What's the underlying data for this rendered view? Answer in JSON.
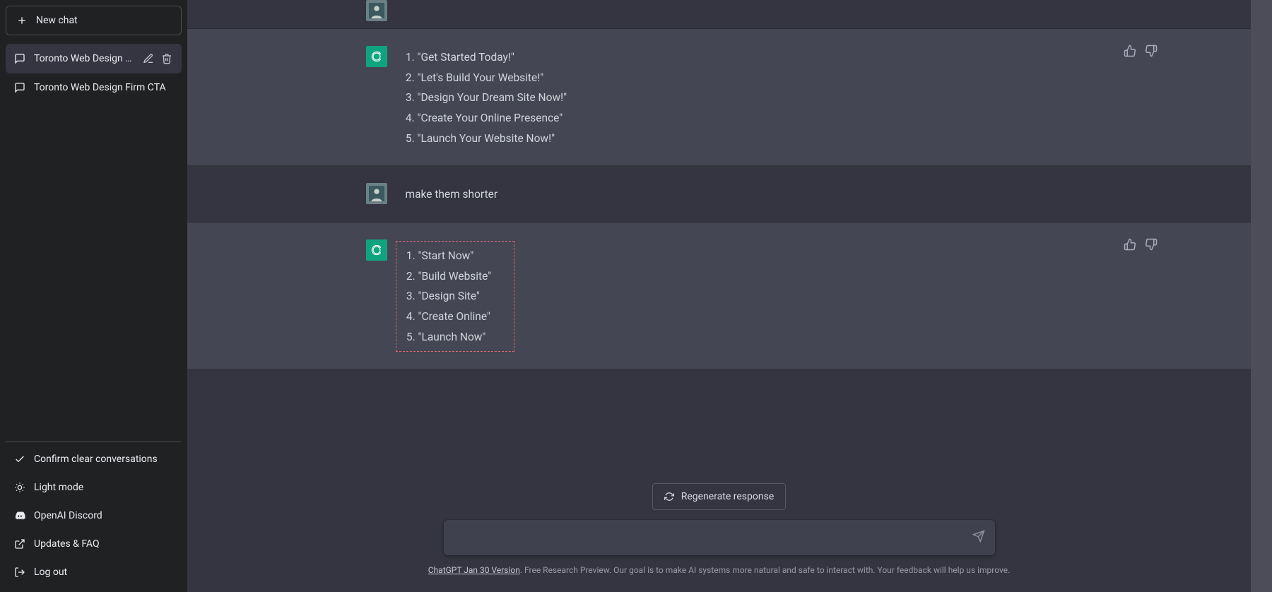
{
  "sidebar": {
    "new_chat": "New chat",
    "chats": [
      {
        "title": "Toronto Web Design SI",
        "active": true
      },
      {
        "title": "Toronto Web Design Firm CTA",
        "active": false
      }
    ],
    "bottom": {
      "clear": "Confirm clear conversations",
      "theme": "Light mode",
      "discord": "OpenAI Discord",
      "updates": "Updates & FAQ",
      "logout": "Log out"
    }
  },
  "conversation": {
    "assist1": {
      "items": [
        "\"Get Started Today!\"",
        "\"Let's Build Your Website!\"",
        "\"Design Your Dream Site Now!\"",
        "\"Create Your Online Presence\"",
        "\"Launch Your Website Now!\""
      ]
    },
    "user1": {
      "text": "make them shorter"
    },
    "assist2": {
      "items": [
        "\"Start Now\"",
        "\"Build Website\"",
        "\"Design Site\"",
        "\"Create Online\"",
        "\"Launch Now\""
      ]
    }
  },
  "controls": {
    "regenerate": "Regenerate response",
    "input_placeholder": ""
  },
  "footer": {
    "version": "ChatGPT Jan 30 Version",
    "rest": ". Free Research Preview. Our goal is to make AI systems more natural and safe to interact with. Your feedback will help us improve."
  }
}
